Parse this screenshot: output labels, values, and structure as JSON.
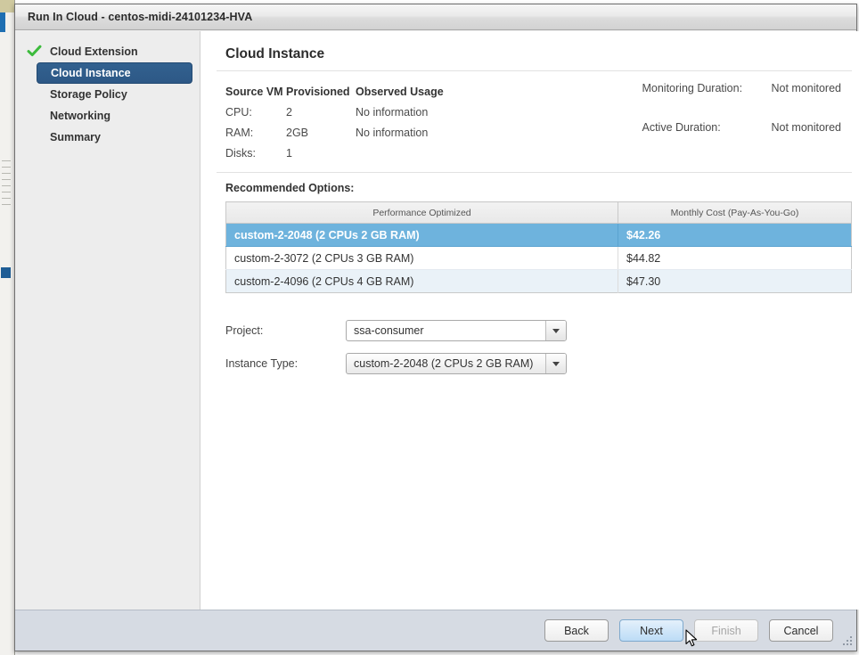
{
  "window": {
    "title": "Run In Cloud - centos-midi-24101234-HVA"
  },
  "sidebar": {
    "items": [
      {
        "label": "Cloud Extension",
        "state": "done"
      },
      {
        "label": "Cloud Instance",
        "state": "selected"
      },
      {
        "label": "Storage Policy",
        "state": "normal"
      },
      {
        "label": "Networking",
        "state": "normal"
      },
      {
        "label": "Summary",
        "state": "normal"
      }
    ],
    "check_icon": "green-check-icon"
  },
  "main": {
    "page_title": "Cloud Instance",
    "summary": {
      "headers": [
        "Source VM",
        "Provisioned",
        "Observed Usage"
      ],
      "rows": [
        {
          "label": "CPU:",
          "provisioned": "2",
          "observed": "No information"
        },
        {
          "label": "RAM:",
          "provisioned": "2GB",
          "observed": "No information"
        },
        {
          "label": "Disks:",
          "provisioned": "1",
          "observed": ""
        }
      ],
      "monitoring": [
        {
          "label": "Monitoring Duration:",
          "value": "Not monitored"
        },
        {
          "label": "Active Duration:",
          "value": "Not monitored"
        }
      ]
    },
    "recommended": {
      "label": "Recommended Options:",
      "columns": [
        "Performance Optimized",
        "Monthly Cost (Pay-As-You-Go)"
      ],
      "rows": [
        {
          "name": "custom-2-2048 (2 CPUs 2 GB RAM)",
          "cost": "$42.26",
          "selected": true
        },
        {
          "name": "custom-2-3072 (2 CPUs 3 GB RAM)",
          "cost": "$44.82",
          "selected": false
        },
        {
          "name": "custom-2-4096 (2 CPUs 4 GB RAM)",
          "cost": "$47.30",
          "selected": false
        }
      ]
    },
    "form": {
      "project": {
        "label": "Project:",
        "value": "ssa-consumer",
        "dropdown_icon": "chevron-down-icon"
      },
      "instance_type": {
        "label": "Instance Type:",
        "value": "custom-2-2048 (2 CPUs 2 GB RAM)",
        "dropdown_icon": "chevron-down-icon"
      }
    }
  },
  "footer": {
    "buttons": [
      {
        "label": "Back",
        "state": "normal"
      },
      {
        "label": "Next",
        "state": "hover"
      },
      {
        "label": "Finish",
        "state": "disabled"
      },
      {
        "label": "Cancel",
        "state": "normal"
      }
    ],
    "grip_icon": "resize-grip-icon"
  },
  "colors": {
    "selected_nav": "#2d5886",
    "selected_row": "#6eb3dd",
    "alt_row": "#eaf2f8",
    "check_green": "#3cbb3c",
    "footer_bg": "#d6dbe3",
    "hover_button": "#bcdcf6"
  }
}
